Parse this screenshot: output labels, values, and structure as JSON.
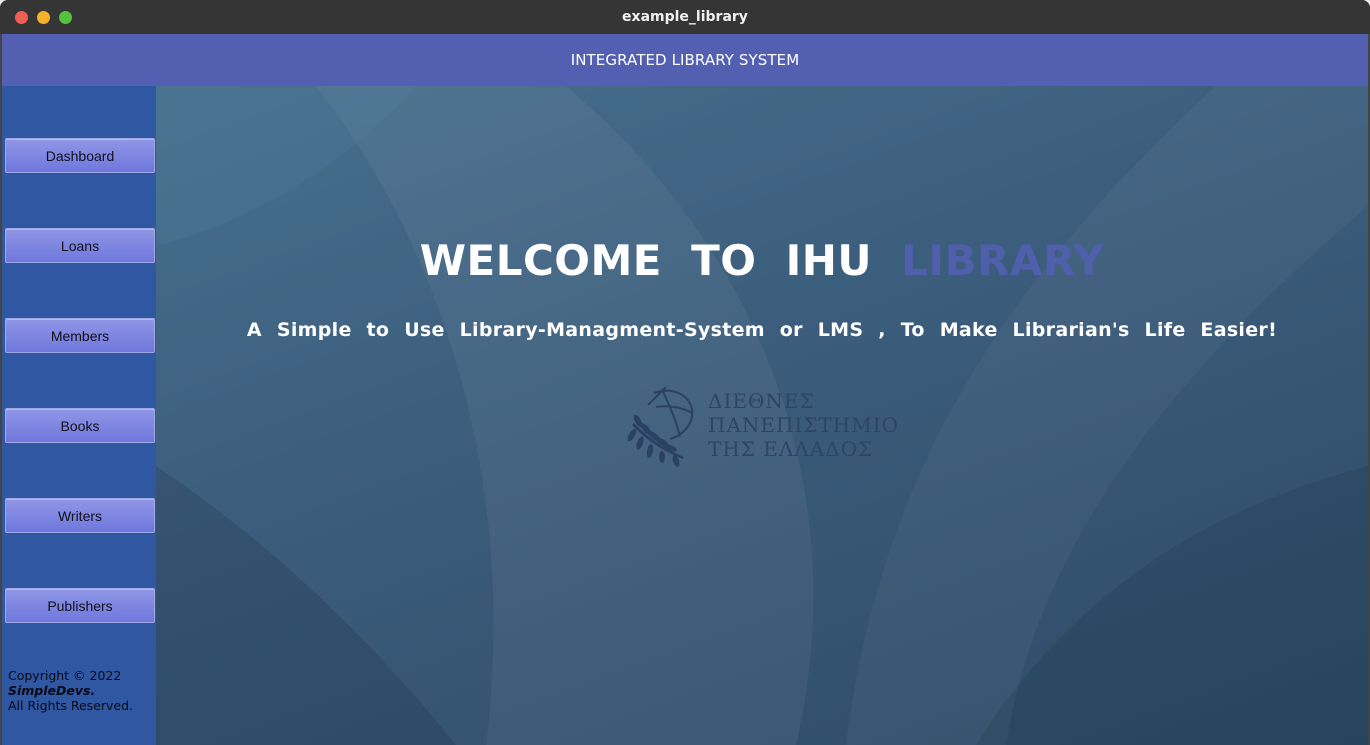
{
  "window": {
    "title": "example_library"
  },
  "header": {
    "title": "INTEGRATED LIBRARY SYSTEM"
  },
  "sidebar": {
    "items": [
      {
        "label": "Dashboard"
      },
      {
        "label": "Loans"
      },
      {
        "label": "Members"
      },
      {
        "label": "Books"
      },
      {
        "label": "Writers"
      },
      {
        "label": "Publishers"
      }
    ],
    "copyright": {
      "line1": "Copyright © 2022",
      "brand": "SimpleDevs.",
      "line3": "All Rights Reserved."
    }
  },
  "main": {
    "welcome_prefix": "WELCOME TO IHU",
    "welcome_accent": "LIBRARY",
    "subtitle": "A Simple to Use Library-Managment-System or LMS , To Make Librarian's Life Easier!",
    "logo": {
      "icon": "olive-branch-globe-icon",
      "line1": "ΔΙΕΘΝΕΣ",
      "line2": "ΠΑΝΕΠΙΣΤΗΜΙΟ",
      "line3": "ΤΗΣ ΕΛΛΑΔΟΣ"
    }
  },
  "colors": {
    "header_bg": "#535fb1",
    "sidebar_bg": "#2f57a2",
    "content_bg": "#3b5c7b",
    "accent": "#4f5fab",
    "button_bg": "#7a82e0"
  }
}
